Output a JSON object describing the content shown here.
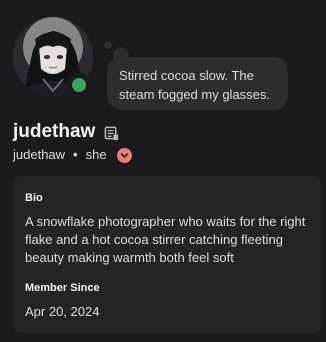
{
  "profile": {
    "display_name": "judethaw",
    "username": "judethaw",
    "separator": "•",
    "pronouns": "she",
    "status": "online",
    "status_color": "#3ba55c",
    "badge_color": "#e8806e"
  },
  "custom_status": {
    "text": "Stirred cocoa slow. The steam fogged my glasses."
  },
  "about": {
    "bio_label": "Bio",
    "bio_text": "A snowflake photographer who waits for the right flake and a hot cocoa stirrer catching fleeting beauty making warmth both feel soft",
    "member_since_label": "Member Since",
    "member_since_value": "Apr 20, 2024"
  },
  "icons": {
    "name_icon": "notes-icon",
    "badge_icon": "chevron-down-icon",
    "avatar": "anime-character-avatar"
  }
}
